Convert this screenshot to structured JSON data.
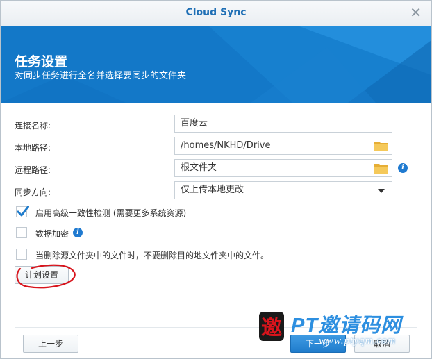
{
  "window": {
    "title": "Cloud Sync",
    "close_symbol": "✕"
  },
  "banner": {
    "heading": "任务设置",
    "subheading": "对同步任务进行全名并选择要同步的文件夹"
  },
  "form": {
    "connection_name_label": "连接名称:",
    "connection_name_value": "百度云",
    "local_path_label": "本地路径:",
    "local_path_value": "/homes/NKHD/Drive",
    "remote_path_label": "远程路径:",
    "remote_path_value": "根文件夹",
    "sync_direction_label": "同步方向:",
    "sync_direction_value": "仅上传本地更改"
  },
  "options": {
    "consistency_check_label": "启用高级一致性检测 (需要更多系统资源)",
    "consistency_check_checked": true,
    "encryption_label": "数据加密",
    "encryption_checked": false,
    "no_delete_label": "当删除源文件夹中的文件时，不要删除目的地文件夹中的文件。",
    "no_delete_checked": false
  },
  "buttons": {
    "schedule_label": "计划设置",
    "back_label": "上一步",
    "next_label": "下一步",
    "cancel_label": "取消"
  },
  "watermark": {
    "logo_char": "邀",
    "text": "PT邀请码网",
    "url": "www.ptyqm.com"
  },
  "colors": {
    "accent": "#1f7ccc",
    "banner": "#1378c8",
    "title": "#1f6fb5",
    "annotation": "#d8141c",
    "folder": "#f2c44e"
  }
}
